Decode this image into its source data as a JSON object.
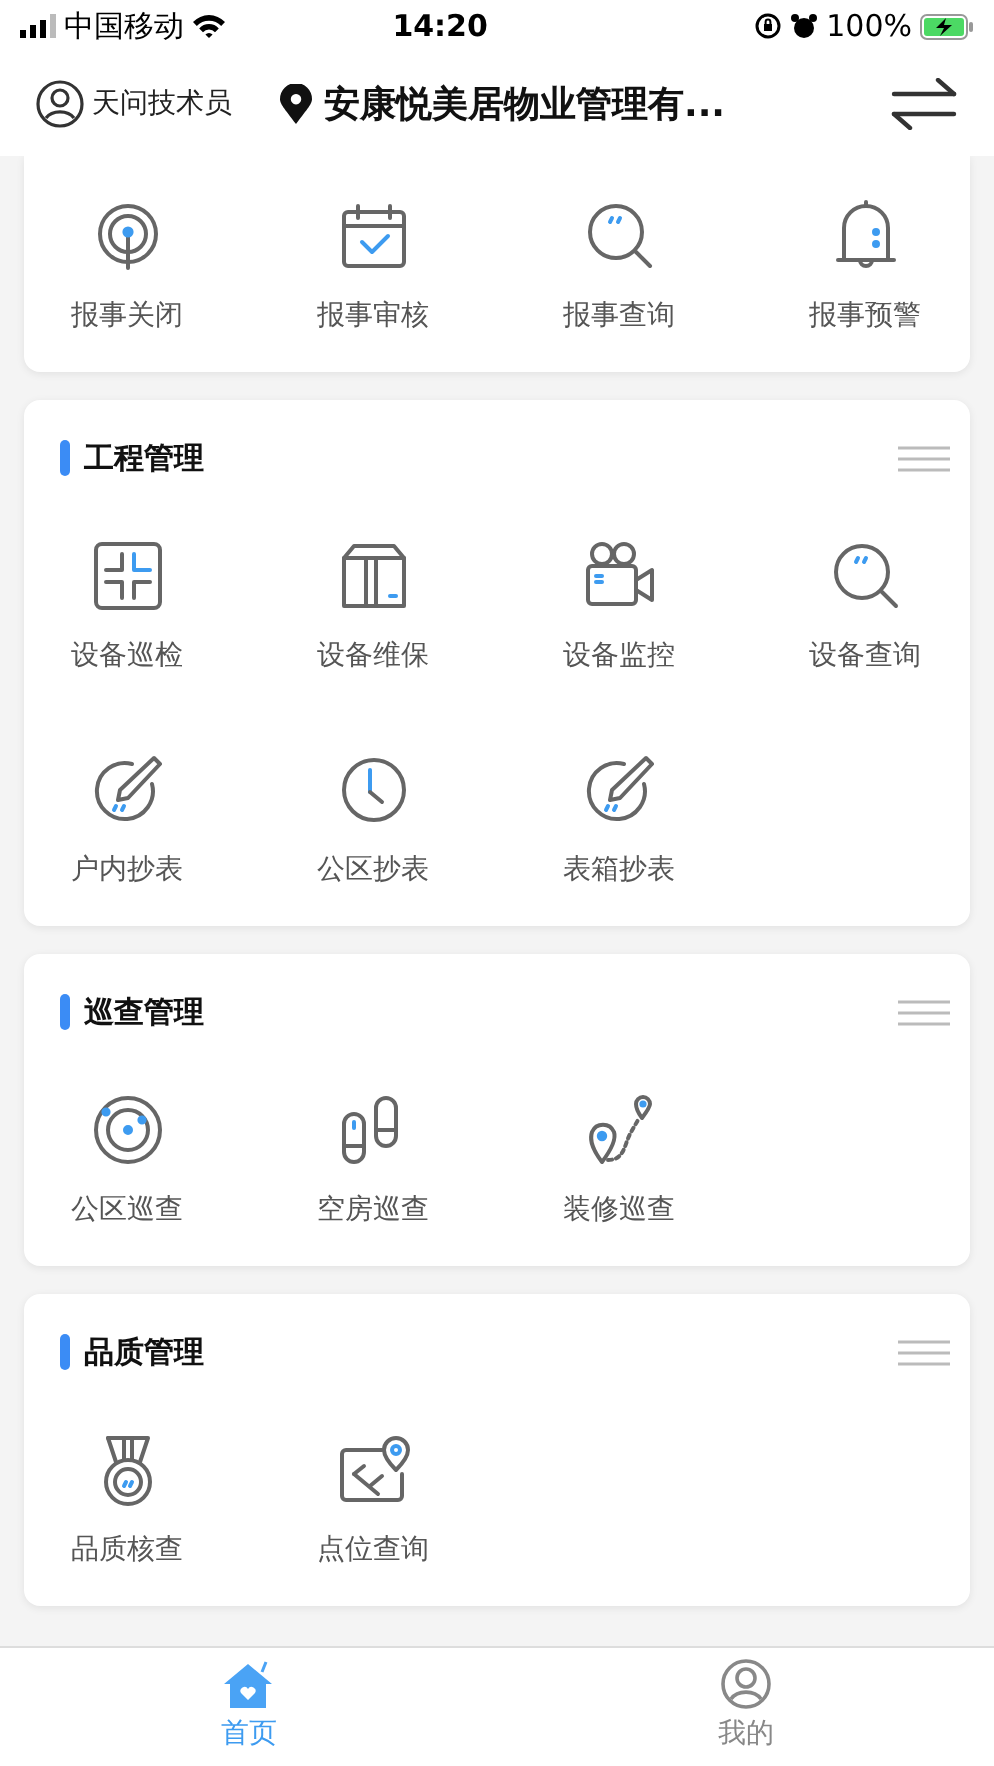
{
  "status_bar": {
    "carrier": "中国移动",
    "time": "14:20",
    "battery": "100%"
  },
  "header": {
    "user": "天问技术员",
    "location": "安康悦美居物业管理有..."
  },
  "sections": [
    {
      "items": [
        {
          "label": "报事关闭",
          "kind": "broadcast"
        },
        {
          "label": "报事审核",
          "kind": "calendar"
        },
        {
          "label": "报事查询",
          "kind": "search"
        },
        {
          "label": "报事预警",
          "kind": "bell"
        }
      ]
    },
    {
      "title": "工程管理",
      "items": [
        {
          "label": "设备巡检",
          "kind": "frame"
        },
        {
          "label": "设备维保",
          "kind": "cabinet"
        },
        {
          "label": "设备监控",
          "kind": "camera"
        },
        {
          "label": "设备查询",
          "kind": "search"
        },
        {
          "label": "户内抄表",
          "kind": "edit"
        },
        {
          "label": "公区抄表",
          "kind": "clock"
        },
        {
          "label": "表箱抄表",
          "kind": "edit"
        }
      ]
    },
    {
      "title": "巡查管理",
      "items": [
        {
          "label": "公区巡查",
          "kind": "target"
        },
        {
          "label": "空房巡查",
          "kind": "footprints"
        },
        {
          "label": "装修巡查",
          "kind": "route"
        }
      ]
    },
    {
      "title": "品质管理",
      "items": [
        {
          "label": "品质核查",
          "kind": "medal"
        },
        {
          "label": "点位查询",
          "kind": "map"
        }
      ]
    }
  ],
  "tabs": [
    {
      "label": "首页",
      "kind": "home",
      "selected": true
    },
    {
      "label": "我的",
      "kind": "profile",
      "selected": false
    }
  ]
}
